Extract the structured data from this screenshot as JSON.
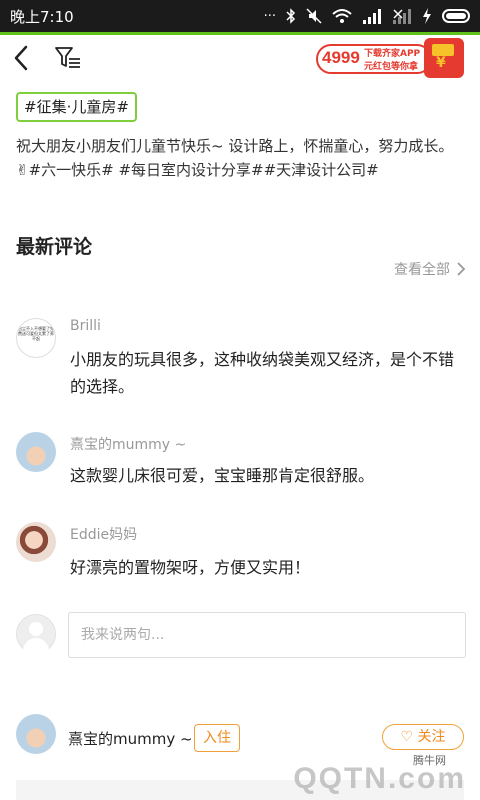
{
  "status_bar": {
    "time": "晚上7:10",
    "icons": [
      "dots-icon",
      "bluetooth-icon",
      "mute-icon",
      "wifi-icon",
      "signal-icon",
      "signal2-icon",
      "charging-icon",
      "battery-icon"
    ]
  },
  "promo": {
    "amount": "4999",
    "line1": "下载齐家APP",
    "line2": "元红包等你拿"
  },
  "post": {
    "tag": "#征集·儿童房#",
    "description": "祝大朋友小朋友们儿童节快乐~ 设计路上，怀揣童心，努力成长。✌#六一快乐# #每日室内设计分享##天津设计公司#"
  },
  "comments_section": {
    "title": "最新评论",
    "see_all": "查看全部",
    "comments": [
      {
        "user": "Brilli",
        "text": "小朋友的玩具很多，这种收纳袋美观又经济，是个不错的选择。",
        "avatar_text": "出尘不入不想要了免费送可爱但太累了养不起"
      },
      {
        "user": "熹宝的mummy ~",
        "text": "这款婴儿床很可爱，宝宝睡那肯定很舒服。"
      },
      {
        "user": "Eddie妈妈",
        "text": "好漂亮的置物架呀，方便又实用！"
      }
    ],
    "input_placeholder": "我来说两句..."
  },
  "author": {
    "name": "熹宝的mummy ~",
    "badge": "入住",
    "follow": "关注"
  },
  "watermark": {
    "site": "腾牛网",
    "logo": "QQTN.com"
  },
  "colors": {
    "accent_green": "#7fcf3c",
    "orange": "#f08a1a",
    "promo_red": "#e53a2f"
  }
}
